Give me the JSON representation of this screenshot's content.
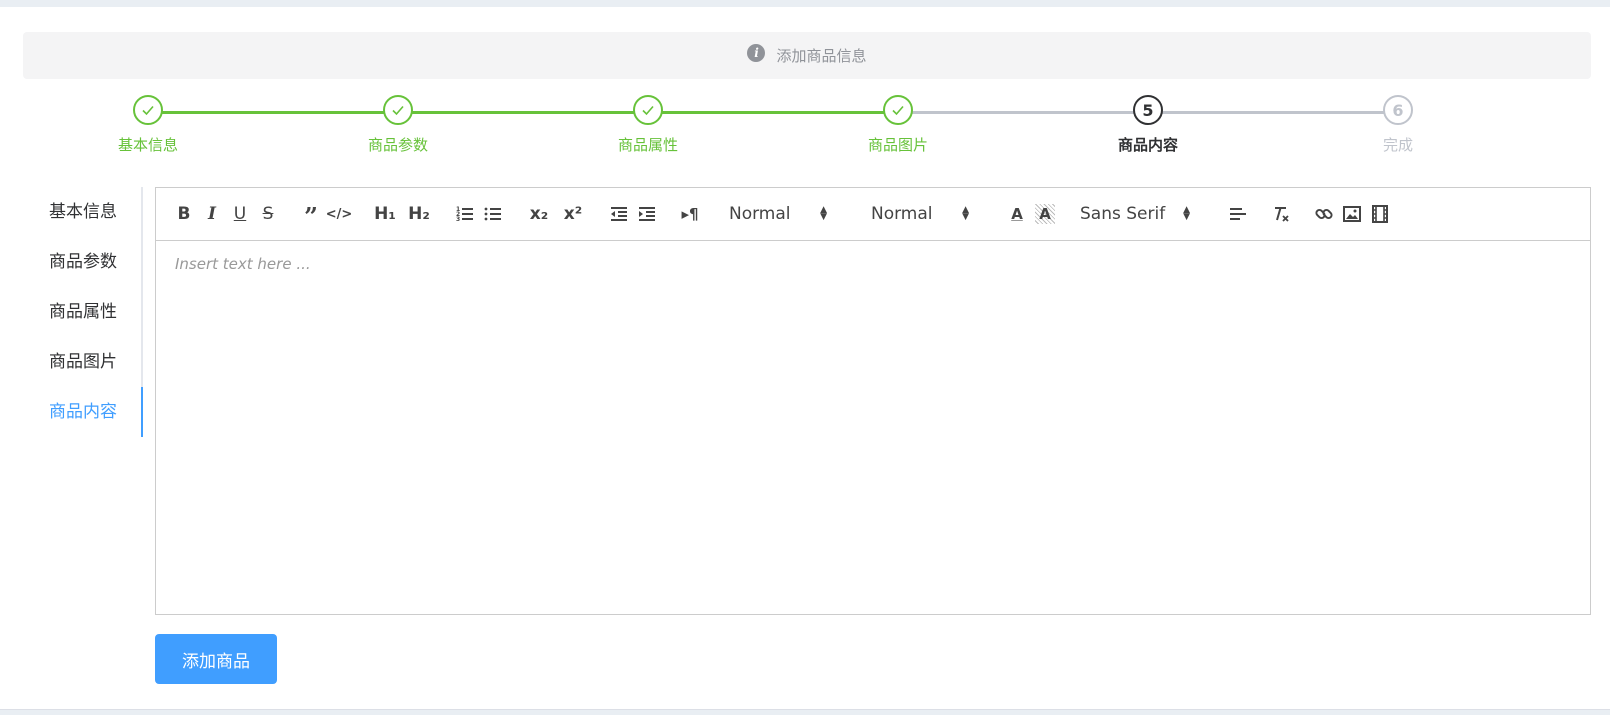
{
  "alert": {
    "text": "添加商品信息",
    "icon": "info-icon"
  },
  "steps": [
    {
      "num": "1",
      "label": "基本信息",
      "status": "finish"
    },
    {
      "num": "2",
      "label": "商品参数",
      "status": "finish"
    },
    {
      "num": "3",
      "label": "商品属性",
      "status": "finish"
    },
    {
      "num": "4",
      "label": "商品图片",
      "status": "finish"
    },
    {
      "num": "5",
      "label": "商品内容",
      "status": "process"
    },
    {
      "num": "6",
      "label": "完成",
      "status": "wait"
    }
  ],
  "tabs": [
    {
      "label": "基本信息",
      "active": false
    },
    {
      "label": "商品参数",
      "active": false
    },
    {
      "label": "商品属性",
      "active": false
    },
    {
      "label": "商品图片",
      "active": false
    },
    {
      "label": "商品内容",
      "active": true
    }
  ],
  "editor": {
    "placeholder": "Insert text here ...",
    "size_select": "Normal",
    "header_select": "Normal",
    "font_select": "Sans Serif",
    "text_buttons": {
      "bold": "B",
      "italic": "I",
      "underline": "U",
      "strike": "S",
      "h1": "H₁",
      "h2": "H₂",
      "sub": "x₂",
      "sup": "x²",
      "direction": "▸¶",
      "color": "A",
      "background": "A"
    }
  },
  "submit_button": "添加商品",
  "colors": {
    "success": "#67c23a",
    "primary": "#409eff",
    "wait": "#c0c4cc",
    "text": "#303133"
  }
}
